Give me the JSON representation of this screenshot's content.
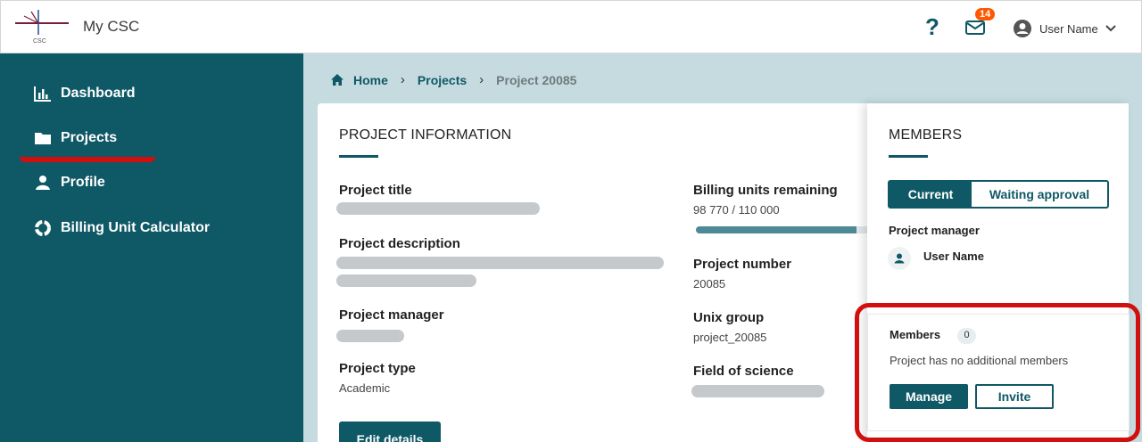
{
  "app": {
    "logo_text": "CSC",
    "title": "My CSC"
  },
  "header": {
    "help_symbol": "?",
    "notifications": "14",
    "user_name": "User Name"
  },
  "sidebar": {
    "items": [
      {
        "label": "Dashboard",
        "icon": "bar-chart-icon"
      },
      {
        "label": "Projects",
        "icon": "folder-icon",
        "active": true
      },
      {
        "label": "Profile",
        "icon": "person-icon"
      },
      {
        "label": "Billing Unit Calculator",
        "icon": "calculator-icon"
      }
    ]
  },
  "breadcrumb": {
    "home": "Home",
    "projects": "Projects",
    "current": "Project 20085"
  },
  "project_info": {
    "section_title": "PROJECT INFORMATION",
    "title_label": "Project title",
    "description_label": "Project description",
    "manager_label": "Project manager",
    "type_label": "Project type",
    "type_value": "Academic",
    "billing_label": "Billing units remaining",
    "billing_value": "98 770 / 110 000",
    "billing_fraction": 0.898,
    "number_label": "Project number",
    "number_value": "20085",
    "unix_label": "Unix group",
    "unix_value": "project_20085",
    "field_label": "Field of science",
    "edit_button": "Edit details"
  },
  "members": {
    "section_title": "MEMBERS",
    "tab_current": "Current",
    "tab_waiting": "Waiting approval",
    "pm_label": "Project manager",
    "pm_name": "User Name",
    "members_label": "Members",
    "members_count": "0",
    "empty_text": "Project has no additional members",
    "manage_button": "Manage",
    "invite_button": "Invite"
  },
  "colors": {
    "primary": "#0f5866",
    "highlight": "#d10f0f",
    "badge": "#ff5800"
  }
}
